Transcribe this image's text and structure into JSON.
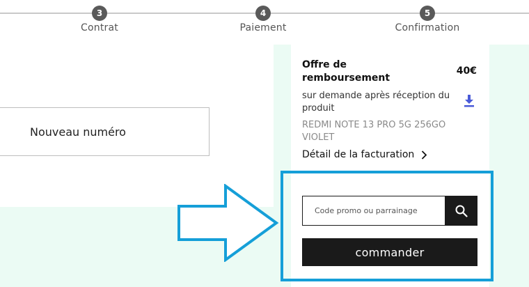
{
  "stepper": {
    "steps": [
      {
        "number": "3",
        "label": "Contrat"
      },
      {
        "number": "4",
        "label": "Paiement"
      },
      {
        "number": "5",
        "label": "Confirmation"
      }
    ]
  },
  "left_panel": {
    "new_number_label": "Nouveau numéro"
  },
  "summary": {
    "offer_title": "Offre de remboursement",
    "offer_price": "40€",
    "offer_description": "sur demande après réception du produit",
    "download_icon": "download-icon",
    "product_name": "REDMI NOTE 13 PRO 5G 256GO VIOLET",
    "billing_link": "Détail de la facturation",
    "promo_placeholder": "Code promo ou parrainage",
    "order_button": "commander"
  },
  "colors": {
    "accent_background": "#ebfbf4",
    "button_dark": "#1a1a1a",
    "download_icon": "#4a5bd8",
    "annotation_blue": "#159fd8"
  }
}
